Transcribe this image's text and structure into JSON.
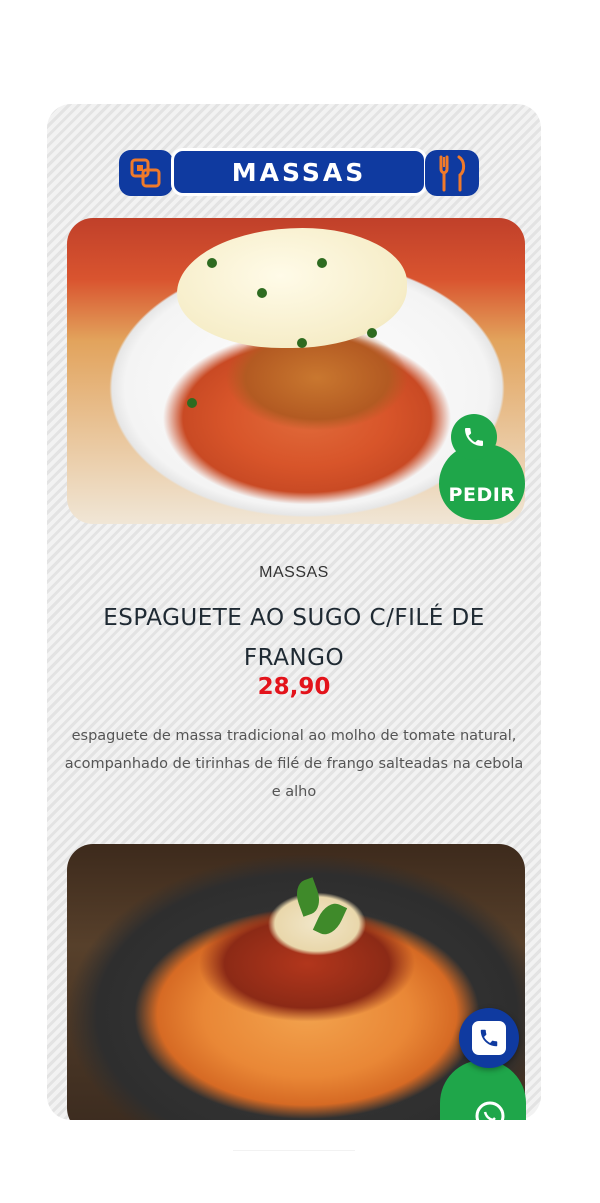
{
  "header": {
    "title": "MASSAS",
    "left_icon": "menu-squares-icon",
    "right_icon": "fork-knife-icon"
  },
  "product": {
    "category": "MASSAS",
    "title": "ESPAGUETE AO SUGO C/FILÉ DE FRANGO",
    "price": "28,90",
    "description": "espaguete de massa tradicional ao molho de tomate natural, acompanhado de tirinhas de filé de frango salteadas na cebola e alho"
  },
  "order_button": {
    "label": "PEDIR",
    "icon": "phone-icon"
  },
  "floating": {
    "phone_icon": "phone-icon",
    "whatsapp_icon": "whatsapp-icon"
  },
  "colors": {
    "brand_blue": "#0f3aa0",
    "order_green": "#1fa64a",
    "price_red": "#e3131b"
  }
}
